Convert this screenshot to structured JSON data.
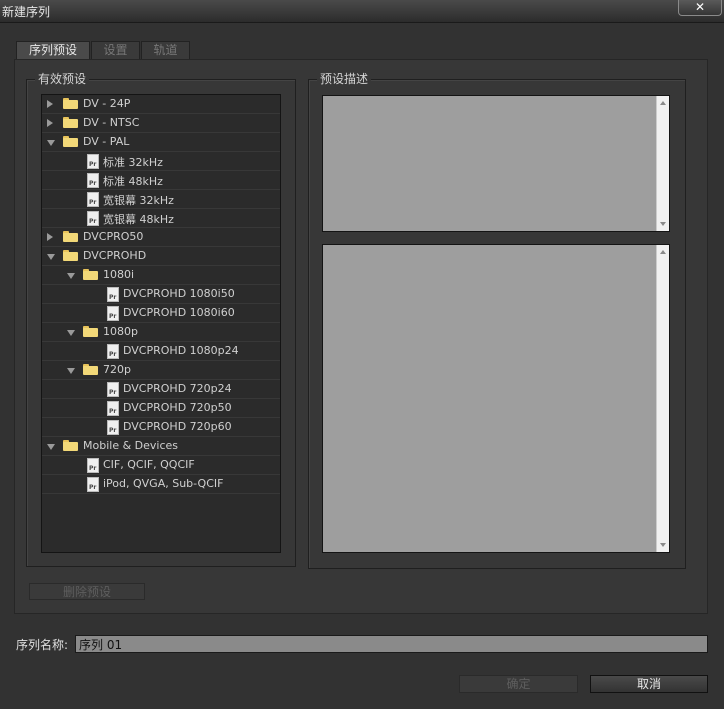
{
  "window": {
    "title": "新建序列",
    "close_glyph": "✕"
  },
  "tabs": [
    {
      "label": "序列预设",
      "active": true
    },
    {
      "label": "设置",
      "active": false
    },
    {
      "label": "轨道",
      "active": false
    }
  ],
  "presets_panel": {
    "label": "有效预设",
    "tree": [
      {
        "label": "DV - 24P",
        "type": "folder",
        "depth": 0,
        "expanded": false
      },
      {
        "label": "DV - NTSC",
        "type": "folder",
        "depth": 0,
        "expanded": false
      },
      {
        "label": "DV - PAL",
        "type": "folder",
        "depth": 0,
        "expanded": true
      },
      {
        "label": "标准 32kHz",
        "type": "file",
        "depth": 1
      },
      {
        "label": "标准 48kHz",
        "type": "file",
        "depth": 1
      },
      {
        "label": "宽银幕 32kHz",
        "type": "file",
        "depth": 1
      },
      {
        "label": "宽银幕 48kHz",
        "type": "file",
        "depth": 1
      },
      {
        "label": "DVCPRO50",
        "type": "folder",
        "depth": 0,
        "expanded": false
      },
      {
        "label": "DVCPROHD",
        "type": "folder",
        "depth": 0,
        "expanded": true
      },
      {
        "label": "1080i",
        "type": "folder",
        "depth": 1,
        "expanded": true
      },
      {
        "label": "DVCPROHD 1080i50",
        "type": "file",
        "depth": 2
      },
      {
        "label": "DVCPROHD 1080i60",
        "type": "file",
        "depth": 2
      },
      {
        "label": "1080p",
        "type": "folder",
        "depth": 1,
        "expanded": true
      },
      {
        "label": "DVCPROHD 1080p24",
        "type": "file",
        "depth": 2
      },
      {
        "label": "720p",
        "type": "folder",
        "depth": 1,
        "expanded": true
      },
      {
        "label": "DVCPROHD 720p24",
        "type": "file",
        "depth": 2
      },
      {
        "label": "DVCPROHD 720p50",
        "type": "file",
        "depth": 2
      },
      {
        "label": "DVCPROHD 720p60",
        "type": "file",
        "depth": 2
      },
      {
        "label": "Mobile & Devices",
        "type": "folder",
        "depth": 0,
        "expanded": true
      },
      {
        "label": "CIF, QCIF, QQCIF",
        "type": "file",
        "depth": 1
      },
      {
        "label": "iPod, QVGA, Sub-QCIF",
        "type": "file",
        "depth": 1
      }
    ]
  },
  "description_panel": {
    "label": "预设描述"
  },
  "delete_preset_button": "删除预设",
  "sequence_name": {
    "label": "序列名称:",
    "value": "序列 01"
  },
  "buttons": {
    "ok": "确定",
    "cancel": "取消"
  },
  "icons": {
    "folder": "folder-icon",
    "file": "premiere-file-icon",
    "expand": "triangle-icon"
  },
  "colors": {
    "background": "#323232",
    "folder": "#f2d878",
    "description_fill": "#9e9e9e"
  }
}
